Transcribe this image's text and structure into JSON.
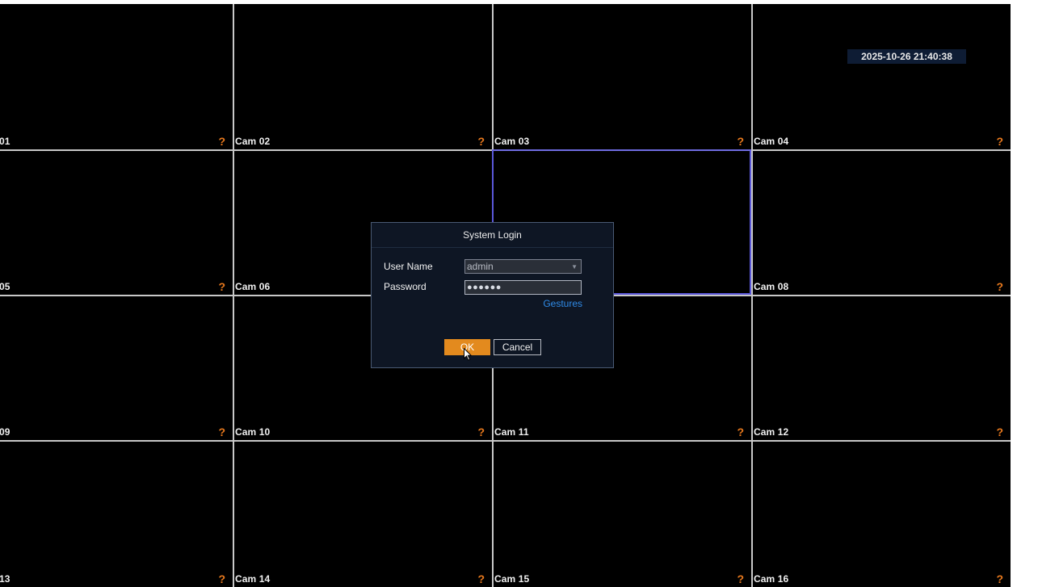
{
  "screen": {
    "background_color": "#000000",
    "grid_line_color": "#c8c8c8",
    "selection_color": "#5a57d8",
    "status_icon_color": "#e8791d"
  },
  "datetime": "2025-10-26 21:40:38",
  "cameras": [
    {
      "label": "01",
      "status_icon": "?"
    },
    {
      "label": "Cam 02",
      "status_icon": "?"
    },
    {
      "label": "Cam 03",
      "status_icon": "?"
    },
    {
      "label": "Cam 04",
      "status_icon": "?"
    },
    {
      "label": "05",
      "status_icon": "?"
    },
    {
      "label": "Cam 06",
      "status_icon": "?"
    },
    {
      "label": "",
      "status_icon": ""
    },
    {
      "label": "Cam 08",
      "status_icon": "?"
    },
    {
      "label": "09",
      "status_icon": "?"
    },
    {
      "label": "Cam 10",
      "status_icon": "?"
    },
    {
      "label": "Cam 11",
      "status_icon": "?"
    },
    {
      "label": "Cam 12",
      "status_icon": "?"
    },
    {
      "label": "13",
      "status_icon": "?"
    },
    {
      "label": "Cam 14",
      "status_icon": "?"
    },
    {
      "label": "Cam 15",
      "status_icon": "?"
    },
    {
      "label": "Cam 16",
      "status_icon": "?"
    }
  ],
  "selected_camera_index": 6,
  "login_dialog": {
    "title": "System Login",
    "username_label": "User Name",
    "username_value": "admin",
    "password_label": "Password",
    "password_value": "●●●●●●",
    "gestures_link": "Gestures",
    "ok_label": "OK",
    "cancel_label": "Cancel",
    "ok_color": "#e38a1e",
    "link_color": "#2f8ae6"
  }
}
